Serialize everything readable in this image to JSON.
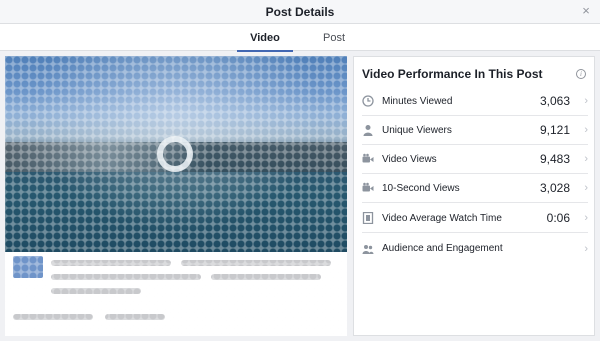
{
  "dialog": {
    "title": "Post Details",
    "close_glyph": "×"
  },
  "tabs": [
    {
      "label": "Video",
      "active": true
    },
    {
      "label": "Post",
      "active": false
    }
  ],
  "metrics": {
    "title": "Video Performance In This Post",
    "info_glyph": "i",
    "rows": [
      {
        "icon": "clock-icon",
        "label": "Minutes Viewed",
        "value": "3,063"
      },
      {
        "icon": "person-icon",
        "label": "Unique Viewers",
        "value": "9,121"
      },
      {
        "icon": "video-camera-icon",
        "label": "Video Views",
        "value": "9,483"
      },
      {
        "icon": "video-camera-icon",
        "label": "10-Second Views",
        "value": "3,028"
      },
      {
        "icon": "film-icon",
        "label": "Video Average Watch Time",
        "value": "0:06"
      },
      {
        "icon": "people-icon",
        "label": "Audience and Engagement",
        "value": ""
      }
    ],
    "chevron_glyph": "›"
  },
  "colors": {
    "accent": "#4267b2",
    "header_bg": "#f6f7f9",
    "border": "#dddfe2"
  }
}
